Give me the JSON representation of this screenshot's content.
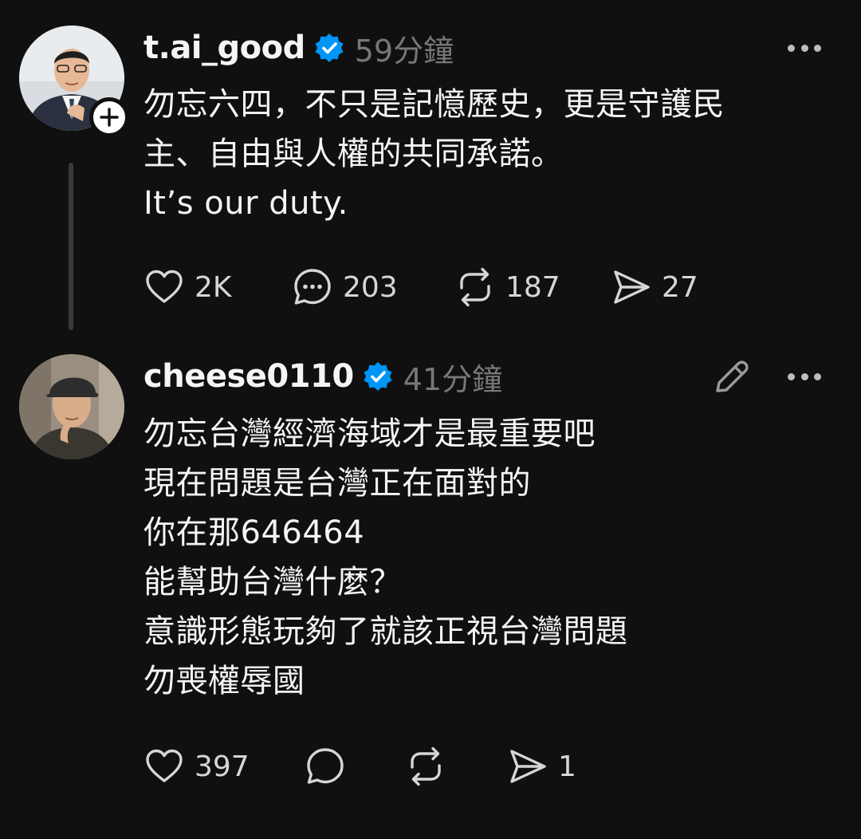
{
  "posts": [
    {
      "username": "t.ai_good",
      "timestamp": "59分鐘",
      "lines": [
        "勿忘六四，不只是記憶歷史，更是守護民",
        "主、自由與人權的共同承諾。",
        "It’s our duty."
      ],
      "likes": "2K",
      "replies": "203",
      "reposts": "187",
      "shares": "27"
    },
    {
      "username": "cheese0110",
      "timestamp": "41分鐘",
      "lines": [
        "勿忘台灣經濟海域才是最重要吧",
        "現在問題是台灣正在面對的",
        "你在那646464",
        "能幫助台灣什麼？",
        "意識形態玩夠了就該正視台灣問題",
        "勿喪權辱國"
      ],
      "likes": "397",
      "replies": "",
      "reposts": "",
      "shares": "1"
    }
  ],
  "colors": {
    "background": "#101010",
    "text": "#f3f5f7",
    "muted": "#777777",
    "verified": "#0095f6",
    "thread_line": "#3a3a3a"
  },
  "icons": {
    "verified": "verified-badge-icon",
    "follow": "plus-icon",
    "more": "more-horizontal-icon",
    "edit": "pencil-icon",
    "like": "heart-icon",
    "reply": "comment-icon",
    "repost": "repost-icon",
    "share": "send-icon"
  }
}
